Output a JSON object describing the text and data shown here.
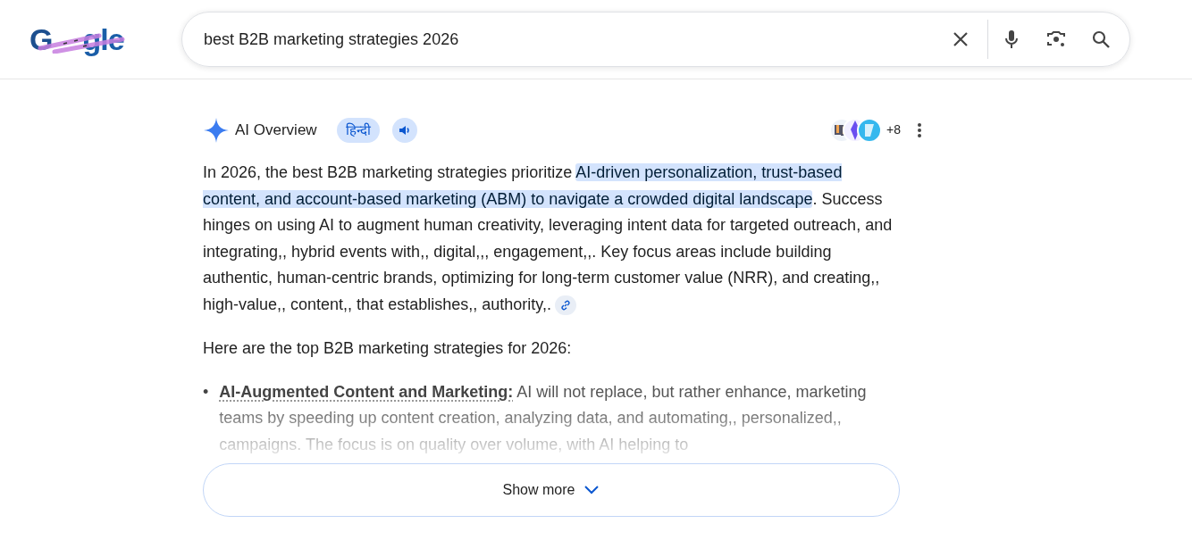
{
  "header": {
    "logo_parts": [
      "G",
      "gle"
    ],
    "search": {
      "value": "best B2B marketing strategies 2026"
    }
  },
  "ai_overview": {
    "title": "AI Overview",
    "language_chip": "हिन्दी",
    "sources_more": "+8",
    "paragraph": [
      {
        "text": "In 2026, the best B2B marketing strategies prioritize ",
        "highlighted": false
      },
      {
        "text": "AI-driven personalization, trust-based content, and account-based marketing (ABM) to navigate a crowded digital landscape",
        "highlighted": true
      },
      {
        "text": ". Success hinges on using AI to augment human creativity, leveraging intent data for targeted outreach, and integrating,, hybrid events with,, digital,,, engagement,,. Key focus areas include building authentic, human-centric brands, optimizing for long-term customer value (NRR), and creating,, high-value,, content,, that establishes,, authority,.",
        "highlighted": false
      }
    ],
    "intro": "Here are the top B2B marketing strategies for 2026:",
    "bullet_marker": "•",
    "bullets": [
      "**AI-Augmented Content and Marketing:** AI will not replace, but rather enhance, marketing teams by speeding up content creation, analyzing data, and automating,, personalized,, campaigns. The focus is on quality over volume, with AI helping to"
    ],
    "show_more": "Show more"
  }
}
